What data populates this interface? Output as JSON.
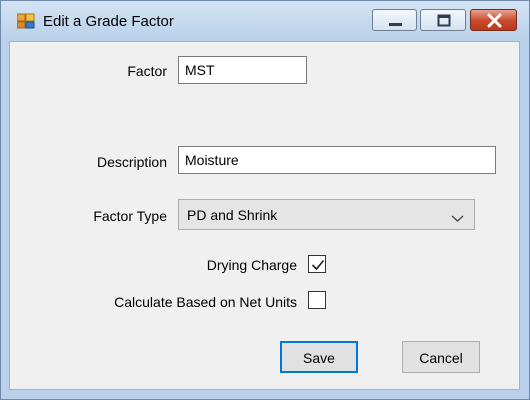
{
  "window": {
    "title": "Edit a Grade Factor"
  },
  "form": {
    "factor": {
      "label": "Factor",
      "value": "MST"
    },
    "description": {
      "label": "Description",
      "value": "Moisture"
    },
    "factor_type": {
      "label": "Factor Type",
      "selected": "PD and Shrink"
    },
    "drying_charge": {
      "label": "Drying Charge",
      "checked": true
    },
    "calc_net_units": {
      "label": "Calculate Based on Net Units",
      "checked": false
    }
  },
  "buttons": {
    "save": "Save",
    "cancel": "Cancel"
  },
  "icons": {
    "app": "app-window-icon",
    "minimize": "minimize-icon",
    "maximize": "maximize-icon",
    "close": "close-icon",
    "dropdown": "chevron-down-icon",
    "check": "checkmark-icon"
  },
  "colors": {
    "title_bar": "#b9d1ea",
    "client_bg": "#f0f0f0",
    "close_button": "#c9482a",
    "default_button_border": "#0078d7"
  }
}
